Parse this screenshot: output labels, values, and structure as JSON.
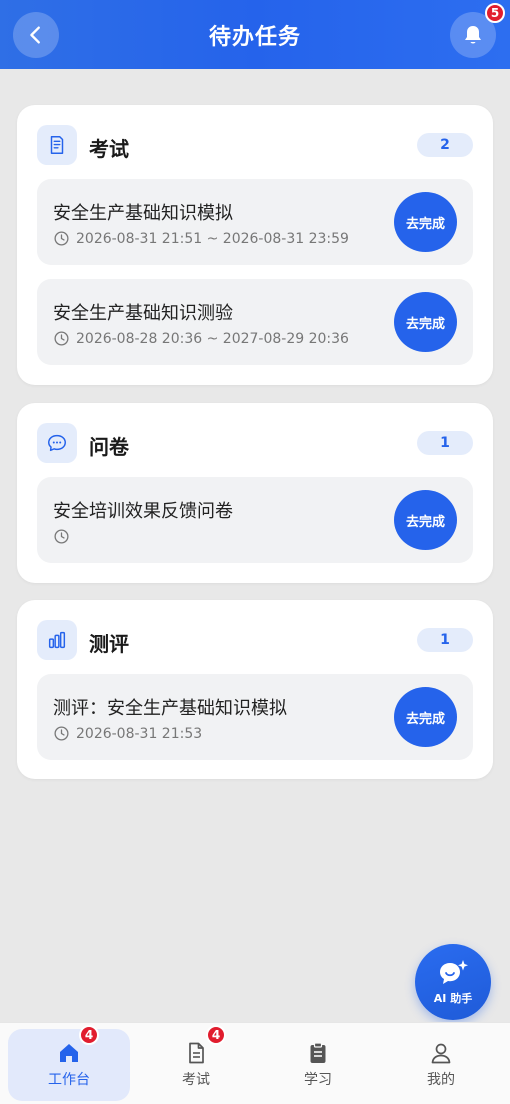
{
  "header": {
    "title": "待办任务",
    "notification_count": "5"
  },
  "sections": [
    {
      "title": "考试",
      "count": "2",
      "icon": "document-icon",
      "tasks": [
        {
          "title": "安全生产基础知识模拟",
          "time": "2026-08-31 21:51 ~ 2026-08-31 23:59",
          "action": "去完成"
        },
        {
          "title": "安全生产基础知识测验",
          "time": "2026-08-28 20:36 ~ 2027-08-29 20:36",
          "action": "去完成"
        }
      ]
    },
    {
      "title": "问卷",
      "count": "1",
      "icon": "chat-bubble-icon",
      "tasks": [
        {
          "title": "安全培训效果反馈问卷",
          "time": "",
          "action": "去完成"
        }
      ]
    },
    {
      "title": "测评",
      "count": "1",
      "icon": "bar-chart-icon",
      "tasks": [
        {
          "title": "测评：安全生产基础知识模拟",
          "time": "2026-08-31 21:53",
          "action": "去完成"
        }
      ]
    }
  ],
  "ai_assistant": {
    "label": "AI 助手"
  },
  "tabbar": {
    "items": [
      {
        "label": "工作台",
        "badge": "4",
        "active": true
      },
      {
        "label": "考试",
        "badge": "4",
        "active": false
      },
      {
        "label": "学习",
        "badge": "",
        "active": false
      },
      {
        "label": "我的",
        "badge": "",
        "active": false
      }
    ]
  },
  "colors": {
    "primary": "#2563eb",
    "badge": "#e11d2e",
    "background": "#e8e8e8"
  }
}
